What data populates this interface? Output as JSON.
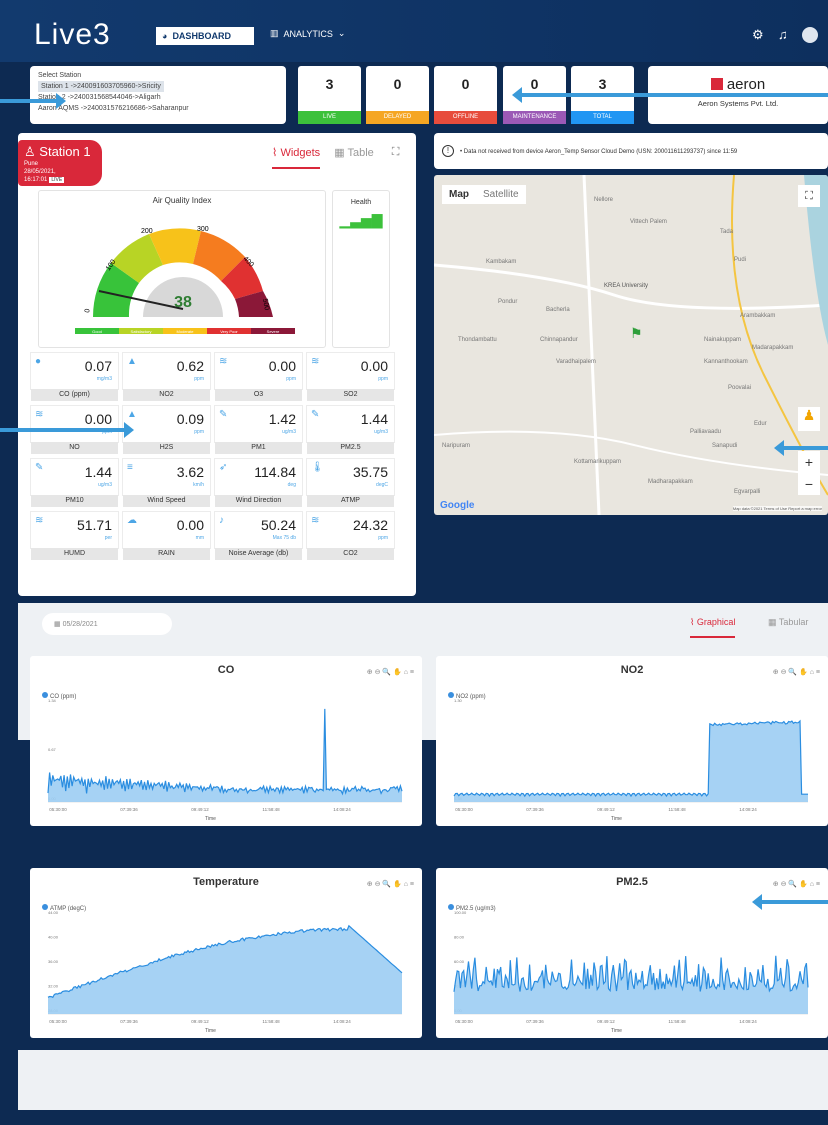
{
  "header": {
    "logo": "Live3",
    "dashboard": "DASHBOARD",
    "analytics": "ANALYTICS"
  },
  "station_select": {
    "label": "Select Station",
    "selected": "Station 1 ->240091603705960->Sricity",
    "line2": "Station 2 ->240031568544046->Aligarh",
    "line3": "Aaron AQMS ->240031576216686->Saharanpur"
  },
  "stats": [
    {
      "value": "3",
      "label": "LIVE",
      "color": "#3cc13b"
    },
    {
      "value": "0",
      "label": "DELAYED",
      "color": "#f5a623"
    },
    {
      "value": "0",
      "label": "OFFLINE",
      "color": "#e74c3c"
    },
    {
      "value": "0",
      "label": "MAINTENANCE",
      "color": "#9b59b6"
    },
    {
      "value": "3",
      "label": "TOTAL",
      "color": "#2196f3"
    }
  ],
  "aeron": {
    "brand": "aeron",
    "company": "Aeron Systems Pvt. Ltd."
  },
  "station": {
    "name": "Station 1",
    "city": "Pune",
    "time": "28/05/2021, 16:17:01",
    "status": "LIVE"
  },
  "view_tabs": {
    "widgets": "Widgets",
    "table": "Table"
  },
  "aqi": {
    "title": "Air Quality Index",
    "value": "38",
    "ticks": [
      "0",
      "100",
      "200",
      "300",
      "400",
      "500"
    ],
    "legend": [
      "Good",
      "Satisfactory",
      "Moderate",
      "Very Poor",
      "Severe"
    ]
  },
  "health": {
    "title": "Health"
  },
  "metrics": [
    {
      "value": "0.07",
      "unit": "mg/m3",
      "name": "CO (ppm)"
    },
    {
      "value": "0.62",
      "unit": "ppm",
      "name": "NO2"
    },
    {
      "value": "0.00",
      "unit": "ppm",
      "name": "O3"
    },
    {
      "value": "0.00",
      "unit": "ppm",
      "name": "SO2"
    },
    {
      "value": "0.00",
      "unit": "ppm",
      "name": "NO"
    },
    {
      "value": "0.09",
      "unit": "ppm",
      "name": "H2S"
    },
    {
      "value": "1.42",
      "unit": "ug/m3",
      "name": "PM1"
    },
    {
      "value": "1.44",
      "unit": "ug/m3",
      "name": "PM2.5"
    },
    {
      "value": "1.44",
      "unit": "ug/m3",
      "name": "PM10"
    },
    {
      "value": "3.62",
      "unit": "km/h",
      "name": "Wind Speed"
    },
    {
      "value": "114.84",
      "unit": "deg",
      "name": "Wind Direction"
    },
    {
      "value": "35.75",
      "unit": "degC",
      "name": "ATMP"
    },
    {
      "value": "51.71",
      "unit": "per",
      "name": "HUMD"
    },
    {
      "value": "0.00",
      "unit": "mm",
      "name": "RAIN"
    },
    {
      "value": "50.24",
      "unit": "Max 75 db",
      "name": "Noise Average (db)"
    },
    {
      "value": "24.32",
      "unit": "ppm",
      "name": "CO2"
    }
  ],
  "notice": "• Data not received from device Aeron_Temp Sensor Cloud Demo (USN: 200011611293737) since 11:59",
  "map": {
    "map": "Map",
    "satellite": "Satellite",
    "google": "Google",
    "footer": "Map data ©2021  Terms of Use  Report a map error",
    "places": [
      "Nellore",
      "Vittech Palem",
      "Kambakam",
      "KREA University",
      "Pondur",
      "Bacherla",
      "Thondambattu",
      "Chinnapandur",
      "Varadhaipalem",
      "Arambakkam",
      "Nainakuppam",
      "Madarapakkam",
      "Kannanthookam",
      "Poovalai",
      "Palliavaadu",
      "Sanapudi",
      "Kottamarikuppam",
      "Madharapakkam",
      "Egvarpalli",
      "Edur",
      "Tada",
      "Pudi",
      "Naripuram"
    ]
  },
  "bottom": {
    "date": "05/28/2021",
    "graphical": "Graphical",
    "tabular": "Tabular"
  },
  "chart_data": [
    {
      "type": "line",
      "title": "CO",
      "legend": "CO (ppm)",
      "xlabel": "Time",
      "x_ticks": [
        "05:30:00",
        "07:39:36",
        "09:49:12",
        "11:58:48",
        "14:08:24"
      ],
      "y_ticks": [
        "1.34",
        "0.67",
        "0.00"
      ],
      "ylim": [
        0,
        1.34
      ]
    },
    {
      "type": "area",
      "title": "NO2",
      "legend": "NO2 (ppm)",
      "xlabel": "Time",
      "x_ticks": [
        "05:30:00",
        "07:39:36",
        "09:49:12",
        "11:58:48",
        "14:08:24"
      ],
      "y_ticks": [
        "1.30",
        "0.34"
      ],
      "ylim": [
        0.34,
        1.3
      ]
    },
    {
      "type": "area",
      "title": "Temperature",
      "legend": "ATMP (degC)",
      "xlabel": "Time",
      "x_ticks": [
        "05:30:00",
        "07:39:36",
        "09:49:12",
        "11:58:48",
        "14:08:24"
      ],
      "y_ticks": [
        "44.00",
        "40.00",
        "36.00",
        "32.00",
        "28.00"
      ],
      "ylim": [
        28,
        44
      ]
    },
    {
      "type": "line",
      "title": "PM2.5",
      "legend": "PM2.5 (ug/m3)",
      "xlabel": "Time",
      "x_ticks": [
        "05:30:00",
        "07:39:36",
        "09:49:12",
        "11:58:48",
        "14:08:24"
      ],
      "y_ticks": [
        "100.00",
        "80.00",
        "60.00",
        "30.00",
        "0.00"
      ],
      "ylim": [
        0,
        100
      ]
    }
  ]
}
